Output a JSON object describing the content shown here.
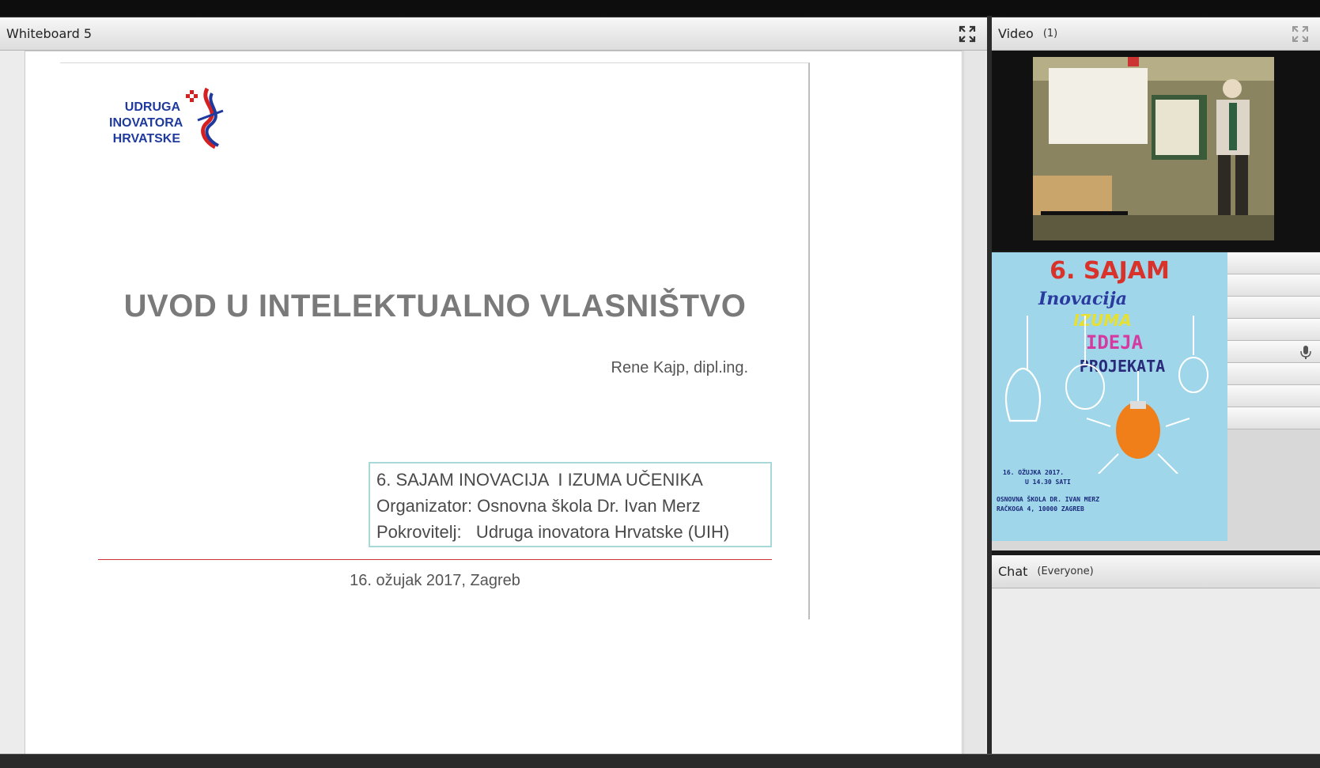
{
  "whiteboard": {
    "title": "Whiteboard 5",
    "slide": {
      "logo_lines": [
        "UDRUGA",
        "INOVATORA",
        "HRVATSKE"
      ],
      "title": "UVOD U INTELEKTUALNO VLASNIŠTVO",
      "author": "Rene Kajp, dipl.ing.",
      "info": [
        "6. SAJAM INOVACIJA  I IZUMA UČENIKA",
        "Organizator: Osnovna škola Dr. Ivan Merz",
        "Pokrovitelj:   Udruga inovatora Hrvatske (UIH)"
      ],
      "date": "16. ožujak 2017, Zagreb"
    },
    "fullscreen_icon": "expand-icon"
  },
  "video": {
    "title": "Video",
    "count": "(1)",
    "fullscreen_icon": "expand-icon"
  },
  "poster": {
    "heading": "6. SAJAM",
    "line1": "Inovacija",
    "line2": "IZUMA",
    "line3": "IDEJA",
    "line4": "PROJEKATA",
    "date_line1": "16. OŽUJKA 2017.",
    "date_line2": "U 14.30 SATI",
    "venue_line1": "OSNOVNA ŠKOLA DR. IVAN MERZ",
    "venue_line2": "RAČKOGA 4, 10000 ZAGREB"
  },
  "chat": {
    "title": "Chat",
    "audience": "(Everyone)"
  },
  "colors": {
    "slide_title": "#7a7a7a",
    "logo_blue": "#1f3a9e",
    "logo_red": "#d42020",
    "poster_bg": "#9fd6ea",
    "poster_red": "#d9322b"
  }
}
